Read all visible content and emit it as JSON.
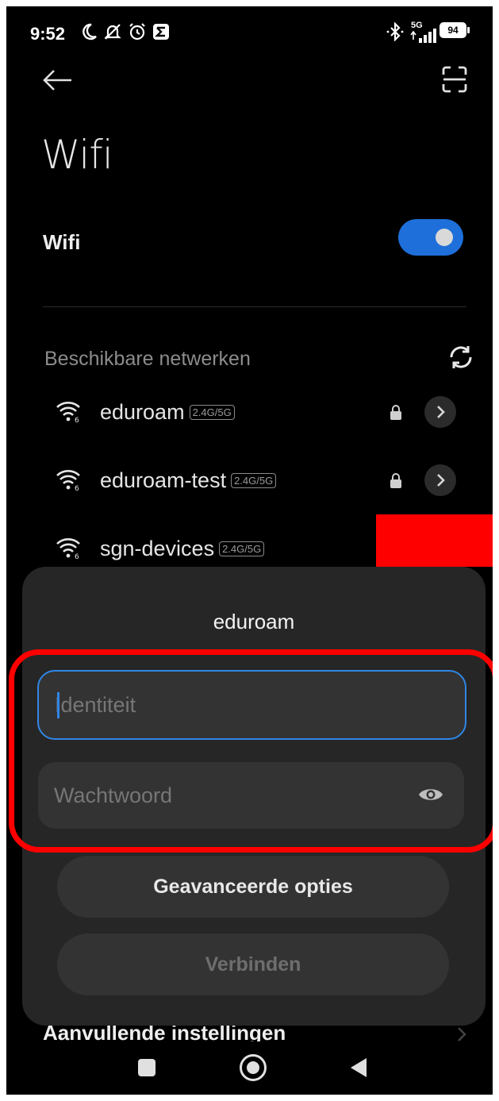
{
  "status_bar": {
    "time": "9:52",
    "network_label": "5G",
    "battery": "94",
    "icons": [
      "moon-icon",
      "mute-icon",
      "alarm-icon",
      "sigma-icon",
      "bluetooth-icon",
      "signal-icon",
      "battery-icon"
    ]
  },
  "header": {
    "title": "Wifi"
  },
  "wifi": {
    "label": "Wifi",
    "enabled": true
  },
  "available": {
    "label": "Beschikbare netwerken",
    "networks": [
      {
        "name": "eduroam",
        "band": "2.4G/5G",
        "secured": true
      },
      {
        "name": "eduroam-test",
        "band": "2.4G/5G",
        "secured": true
      },
      {
        "name": "sgn-devices",
        "band": "2.4G/5G",
        "secured": true
      }
    ]
  },
  "dialog": {
    "title": "eduroam",
    "identity_placeholder": "Identiteit",
    "password_placeholder": "Wachtwoord",
    "advanced_label": "Geavanceerde opties",
    "connect_label": "Verbinden"
  },
  "footer": {
    "additional_settings": "Aanvullende instellingen"
  },
  "colors": {
    "accent": "#1e6fd9",
    "focus": "#2f86e6",
    "highlight": "#fe0000",
    "dialog_bg": "#262626"
  }
}
